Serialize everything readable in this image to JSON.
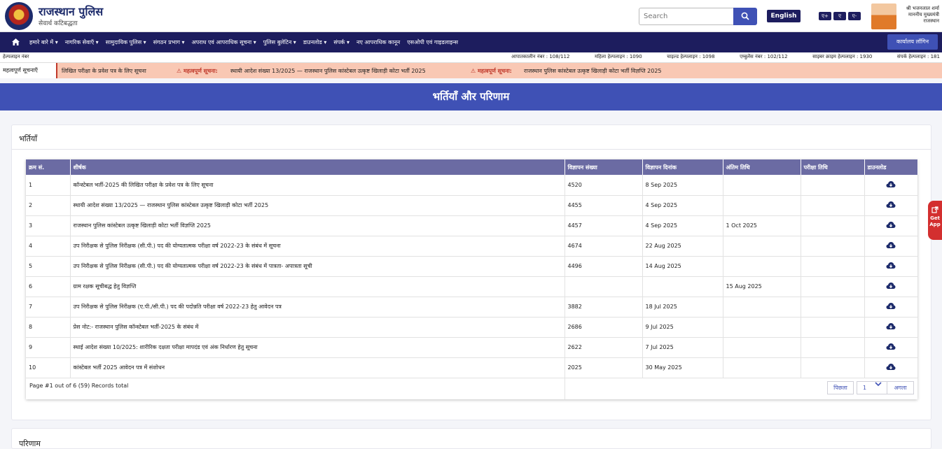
{
  "header": {
    "site_title": "राजस्थान पुलिस",
    "site_subtitle": "सेवार्थ कटिबद्धता",
    "search_placeholder": "Search",
    "language_button": "English",
    "font_sizes": [
      "ए+",
      "ए",
      "ए-"
    ],
    "cm_lines": [
      "श्री भजनलाल शर्मा",
      "माननीय मुख्यमंत्री",
      "राजस्थान"
    ]
  },
  "nav": {
    "items": [
      "हमारे बारे में ▾",
      "नागरिक सेवाएँ ▾",
      "सामुदायिक पुलिस ▾",
      "संगठन प्रभाग ▾",
      "अपराध एवं आपराधिक सूचना ▾",
      "पुलिस बुलेटिन ▾",
      "डाउनलोड ▾",
      "संपर्क ▾",
      "नए आपराधिक कानून",
      "एसओपी एवं गाइडलाइन्स"
    ],
    "login_label": "कार्यालय लॉगिन"
  },
  "helpline": {
    "label": "हेल्पलाइन नंबर",
    "items": [
      "आपातकालीन नंबर : 108/112",
      "महिला हेल्पलाइन : 1090",
      "चाइल्ड हेल्पलाइन : 1098",
      "एम्बुलेंस नंबर : 102/112",
      "साइबर क्राइम हेल्पलाइन : 1930",
      "संपर्क हेल्पलाइन : 181"
    ]
  },
  "notices": {
    "label": "महत्वपूर्ण सूचनाएँ",
    "item1": "लिखित परीक्षा के प्रवेश पत्र के लिए सूचना",
    "warn_label": "⚠ महत्वपूर्ण सूचना:",
    "item2": "स्थायी आदेश संख्या 13/2025 — राजस्थान पुलिस कांस्टेबल उत्कृष्ट खिलाड़ी कोटा भर्ती 2025",
    "item3": "राजस्थान पुलिस कांस्टेबल उत्कृष्ट खिलाड़ी कोटा भर्ती विज्ञप्ति 2025"
  },
  "banner_title": "भर्तियाँ और परिणाम",
  "recruitment": {
    "section_title": "भर्तियाँ",
    "columns": [
      "क्रम सं.",
      "शीर्षक",
      "विज्ञापन संख्या",
      "विज्ञापन दिनांक",
      "अंतिम तिथि",
      "परीक्षा तिथि",
      "डाउनलोड"
    ],
    "rows": [
      [
        "1",
        "कॉन्स्टेबल भर्ती-2025 की लिखित परीक्षा के प्रवेश पत्र के लिए सूचना",
        "4520",
        "8 Sep 2025",
        "",
        ""
      ],
      [
        "2",
        "स्थायी आदेश संख्या 13/2025 — राजस्थान पुलिस कांस्टेबल उत्कृष्ट खिलाड़ी कोटा भर्ती 2025",
        "4455",
        "4 Sep 2025",
        "",
        ""
      ],
      [
        "3",
        "राजस्थान पुलिस कांस्टेबल उत्कृष्ट खिलाड़ी कोटा भर्ती विज्ञप्ति 2025",
        "4457",
        "4 Sep 2025",
        "1 Oct 2025",
        ""
      ],
      [
        "4",
        "उप निरीक्षक से पुलिस निरीक्षक (सी.पी.) पद की योग्यतात्मक परीक्षा वर्ष 2022-23 के संबंध में सूचना",
        "4674",
        "22 Aug 2025",
        "",
        ""
      ],
      [
        "5",
        "उप निरीक्षक से पुलिस निरीक्षक (सी.पी.) पद की योग्यतात्मक परीक्षा वर्ष 2022-23 के संबंध में पात्रता- अपात्रता सूची",
        "4496",
        "14 Aug 2025",
        "",
        ""
      ],
      [
        "6",
        "ग्राम रक्षक सूचीबद्ध हेतु विज्ञप्ति",
        "",
        "",
        "15 Aug 2025",
        ""
      ],
      [
        "7",
        "उप निरीक्षक से पुलिस निरीक्षक (ए.पी./सी.पी.) पद की पदोन्नति परीक्षा वर्ष 2022-23 हेतु आवेदन पत्र",
        "3882",
        "18 Jul 2025",
        "",
        ""
      ],
      [
        "8",
        "प्रेस नोट:- राजस्थान पुलिस कॉन्स्टेबल भर्ती-2025 के संबंध में",
        "2686",
        "9 Jul 2025",
        "",
        ""
      ],
      [
        "9",
        "स्थाई आदेश संख्या 10/2025: शारीरिक दक्षता परीक्षा मापदंड एवं अंक निर्धारण हेतु सूचना",
        "2622",
        "7 Jul 2025",
        "",
        ""
      ],
      [
        "10",
        "कांस्टेबल भर्ती 2025 आवेदन पत्र में संशोधन",
        "2025",
        "30 May 2025",
        "",
        ""
      ]
    ],
    "page_info": "Page #1 out of 6 (59) Records total",
    "prev_label": "पिछला",
    "page_value": "1",
    "next_label": "अगला"
  },
  "results": {
    "section_title": "परिणाम"
  },
  "get_app": "Get App",
  "colors": {
    "nav_bg": "#1d1d5e",
    "accent": "#3f51b5",
    "table_header": "#6b6ba3",
    "notice_bg": "#f9c8b4"
  }
}
